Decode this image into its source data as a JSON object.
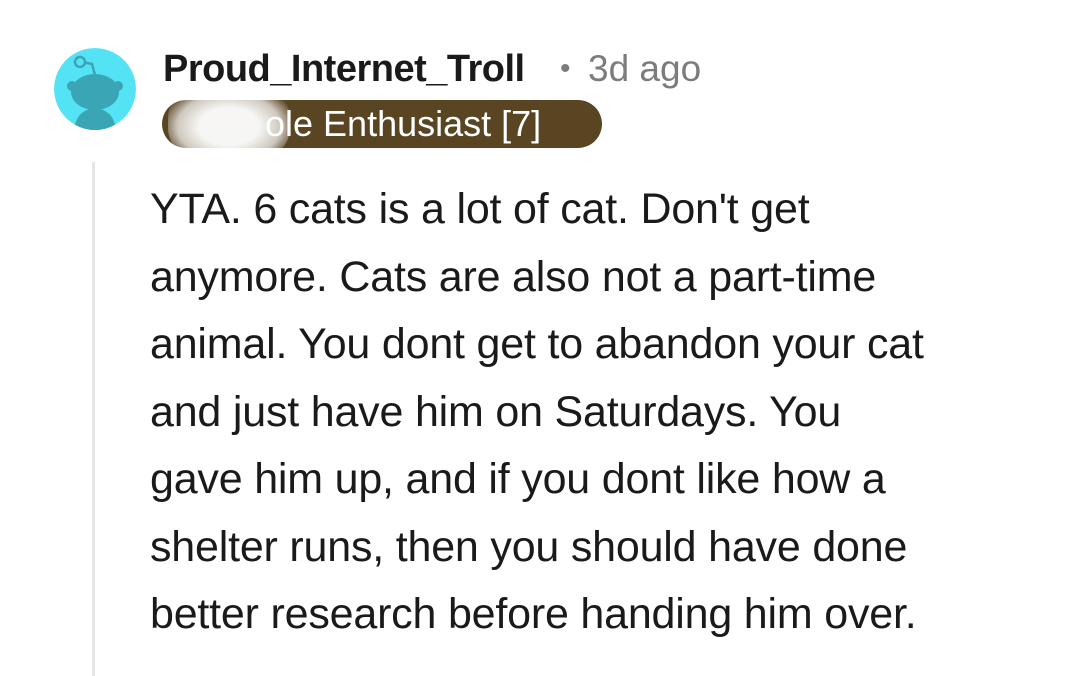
{
  "comment": {
    "username": "Proud_Internet_Troll",
    "separator": "•",
    "timestamp": "3d ago",
    "flair": "ole Enthusiast [7]",
    "body": "YTA. 6 cats is a lot of cat. Don't get\nanymore. Cats are also not a part-time\nanimal. You dont get to abandon your cat\nand just have him on Saturdays. You\ngave him up, and if you dont like how a\nshelter runs, then you should have done\nbetter research before handing him over."
  },
  "colors": {
    "avatar_background": "#54e3f5",
    "avatar_figure": "#3aa5b5",
    "flair_background": "#5a4523",
    "meta_text": "#7c7c7c",
    "thread_line": "#e6e6e6"
  },
  "icons": {
    "avatar": "snoo-avatar-icon"
  }
}
